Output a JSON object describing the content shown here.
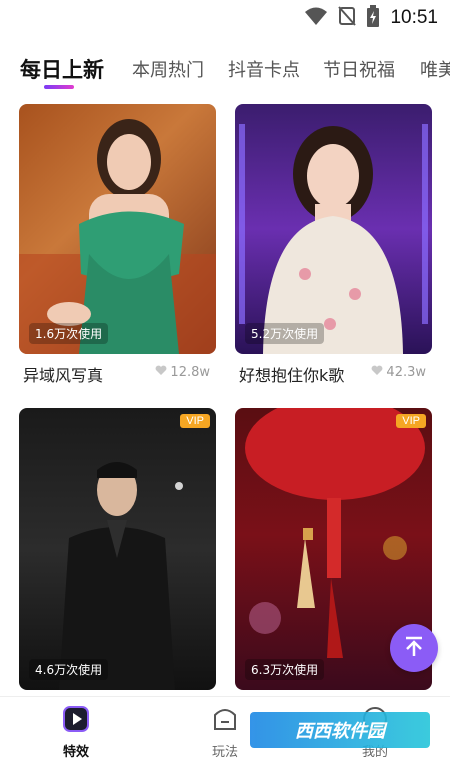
{
  "status": {
    "time": "10:51",
    "icons": [
      "wifi-icon",
      "signal-off-icon",
      "battery-charging-icon"
    ]
  },
  "tabs": [
    {
      "label": "每日上新",
      "active": true
    },
    {
      "label": "本周热门"
    },
    {
      "label": "抖音卡点"
    },
    {
      "label": "节日祝福"
    },
    {
      "label": "唯美"
    }
  ],
  "cards": [
    {
      "title": "异域风写真",
      "usage": "1.6万次使用",
      "likes": "12.8w",
      "vip": false
    },
    {
      "title": "好想抱住你k歌",
      "usage": "5.2万次使用",
      "likes": "42.3w",
      "vip": false
    },
    {
      "title": "",
      "usage": "4.6万次使用",
      "likes": "",
      "vip": true,
      "vip_label": "VIP"
    },
    {
      "title": "",
      "usage": "6.3万次使用",
      "likes": "",
      "vip": true,
      "vip_label": "VIP"
    }
  ],
  "bottom_nav": [
    {
      "label": "特效",
      "icon": "play-square-icon",
      "active": true
    },
    {
      "label": "玩法",
      "icon": "smile-box-icon"
    },
    {
      "label": "我的",
      "icon": "profile-icon"
    }
  ],
  "watermark": "西西软件园",
  "colors": {
    "accent": "#8b5cf6",
    "vip": "#f5a623",
    "indicator_from": "#7b3cf5",
    "indicator_to": "#e03ccf"
  }
}
